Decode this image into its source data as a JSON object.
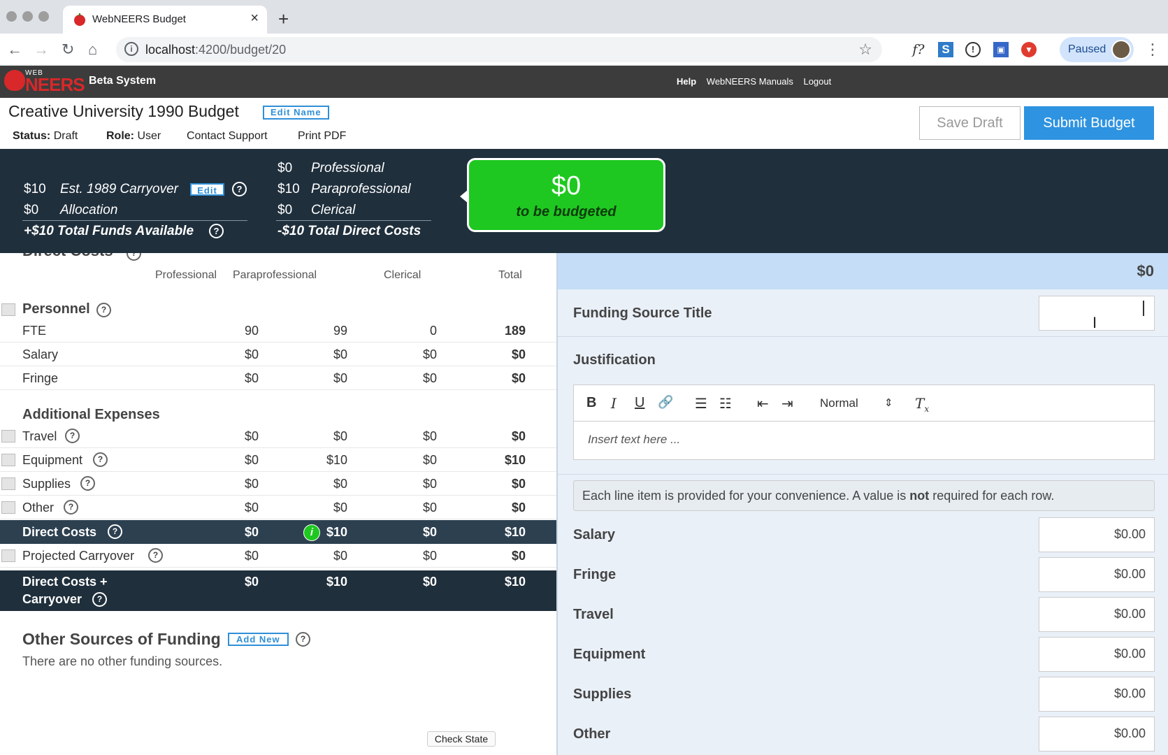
{
  "browser": {
    "tab_title": "WebNEERS Budget",
    "url_host": "localhost",
    "url_rest": ":4200/budget/20",
    "profile_label": "Paused",
    "ext_fx": "f?"
  },
  "app": {
    "logo_small": "WEB",
    "logo_big": "NEERS",
    "system_label": "Beta System",
    "links": [
      "Help",
      "WebNEERS Manuals",
      "Logout"
    ]
  },
  "budget": {
    "title": "Creative University 1990 Budget",
    "edit_name": "Edit Name",
    "status_label": "Status:",
    "status_value": "Draft",
    "role_label": "Role:",
    "role_value": "User",
    "contact_support": "Contact Support",
    "print_pdf": "Print PDF",
    "save_draft": "Save Draft",
    "submit": "Submit Budget"
  },
  "summary": {
    "carryover_amt": "$10",
    "carryover_lbl": "Est. 1989 Carryover",
    "edit": "Edit",
    "allocation_amt": "$0",
    "allocation_lbl": "Allocation",
    "total_funds": "+$10 Total Funds Available",
    "prof_amt": "$0",
    "prof_lbl": "Professional",
    "para_amt": "$10",
    "para_lbl": "Paraprofessional",
    "cler_amt": "$0",
    "cler_lbl": "Clerical",
    "total_direct": "-$10 Total Direct Costs",
    "to_budget_amt": "$0",
    "to_budget_lbl": "to be budgeted"
  },
  "direct_costs": {
    "heading": "Direct Costs",
    "columns": [
      "Professional",
      "Paraprofessional",
      "Clerical",
      "Total"
    ],
    "personnel_label": "Personnel",
    "personnel_rows": [
      {
        "name": "FTE",
        "prof": "90",
        "para": "99",
        "cler": "0",
        "total": "189"
      },
      {
        "name": "Salary",
        "prof": "$0",
        "para": "$0",
        "cler": "$0",
        "total": "$0"
      },
      {
        "name": "Fringe",
        "prof": "$0",
        "para": "$0",
        "cler": "$0",
        "total": "$0"
      }
    ],
    "additional_label": "Additional Expenses",
    "additional_rows": [
      {
        "name": "Travel",
        "prof": "$0",
        "para": "$0",
        "cler": "$0",
        "total": "$0"
      },
      {
        "name": "Equipment",
        "prof": "$0",
        "para": "$10",
        "cler": "$0",
        "total": "$10"
      },
      {
        "name": "Supplies",
        "prof": "$0",
        "para": "$0",
        "cler": "$0",
        "total": "$0"
      },
      {
        "name": "Other",
        "prof": "$0",
        "para": "$0",
        "cler": "$0",
        "total": "$0"
      }
    ],
    "direct_total": {
      "name": "Direct Costs",
      "prof": "$0",
      "para": "$10",
      "cler": "$0",
      "total": "$10"
    },
    "carryover": {
      "name": "Projected Carryover",
      "prof": "$0",
      "para": "$0",
      "cler": "$0",
      "total": "$0"
    },
    "grand_total": {
      "name_1": "Direct Costs +",
      "name_2": "Carryover",
      "prof": "$0",
      "para": "$10",
      "cler": "$0",
      "total": "$10"
    }
  },
  "other_funding": {
    "title": "Other Sources of Funding",
    "add_new": "Add New",
    "empty_text": "There are no other funding sources.",
    "check_state": "Check State"
  },
  "funding_form": {
    "header_amount": "$0",
    "title_label": "Funding Source Title",
    "title_value": "",
    "justification_label": "Justification",
    "editor_format": "Normal",
    "editor_placeholder": "Insert text here ...",
    "note_before": "Each line item is provided for your convenience. A value is ",
    "note_bold": "not",
    "note_after": " required for each row.",
    "lines": [
      {
        "label": "Salary",
        "value": "$0.00"
      },
      {
        "label": "Fringe",
        "value": "$0.00"
      },
      {
        "label": "Travel",
        "value": "$0.00"
      },
      {
        "label": "Equipment",
        "value": "$0.00"
      },
      {
        "label": "Supplies",
        "value": "$0.00"
      },
      {
        "label": "Other",
        "value": "$0.00"
      }
    ]
  }
}
